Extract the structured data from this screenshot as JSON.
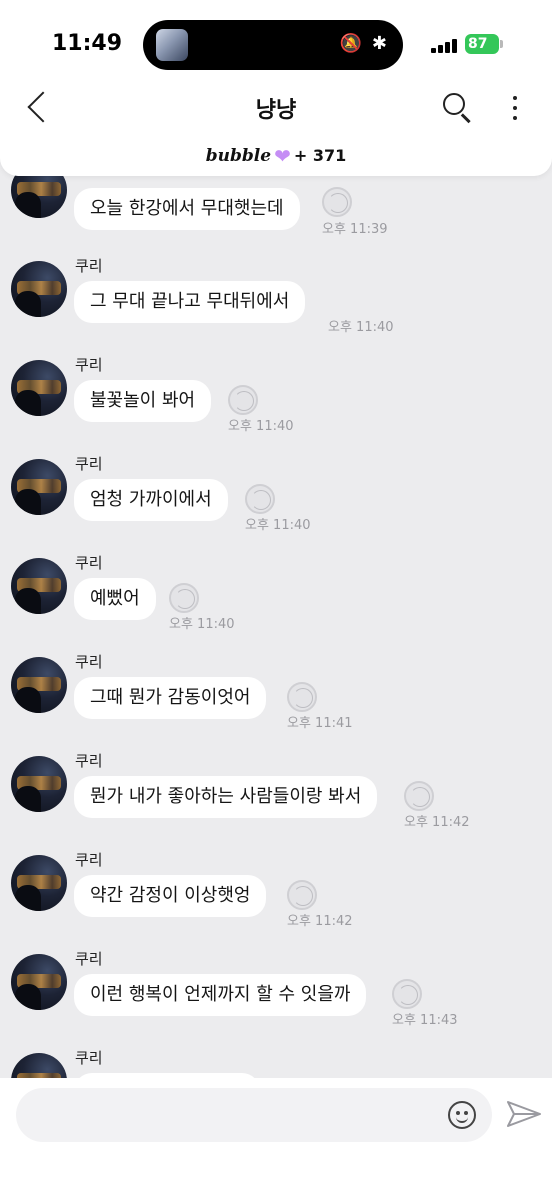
{
  "status_bar": {
    "time": "11:49",
    "battery": "87",
    "island_icons": "🔕 ✱"
  },
  "header": {
    "title": "냥냥",
    "brand": "bubble",
    "member_count": "+ 371"
  },
  "messages": [
    {
      "sender": "",
      "text": "오늘 한강에서 무대햇는데",
      "time": "오후 11:39"
    },
    {
      "sender": "쿠리",
      "text": "그 무대 끝나고 무대뒤에서",
      "time": "오후 11:40"
    },
    {
      "sender": "쿠리",
      "text": "불꽃놀이 봐어",
      "time": "오후 11:40"
    },
    {
      "sender": "쿠리",
      "text": "엄청 가까이에서",
      "time": "오후 11:40"
    },
    {
      "sender": "쿠리",
      "text": "예뻤어",
      "time": "오후 11:40"
    },
    {
      "sender": "쿠리",
      "text": "그때 뭔가 감동이엇어",
      "time": "오후 11:41"
    },
    {
      "sender": "쿠리",
      "text": "뭔가 내가 좋아하는 사람들이랑 봐서",
      "time": "오후 11:42"
    },
    {
      "sender": "쿠리",
      "text": "약간 감정이 이상햇엉",
      "time": "오후 11:42"
    },
    {
      "sender": "쿠리",
      "text": "이런 행복이 언제까지 할 수 잇을까",
      "time": "오후 11:43"
    },
    {
      "sender": "쿠리",
      "text": "",
      "time": ""
    }
  ],
  "colors": {
    "chat_background": "#ececee",
    "bubble": "#ffffff",
    "battery": "#34c759",
    "heart": "#c58ef5"
  },
  "icons": [
    "chevron-left-icon",
    "search-icon",
    "more-vertical-icon",
    "heart-icon",
    "reaction-icon",
    "emoji-icon",
    "send-icon"
  ]
}
